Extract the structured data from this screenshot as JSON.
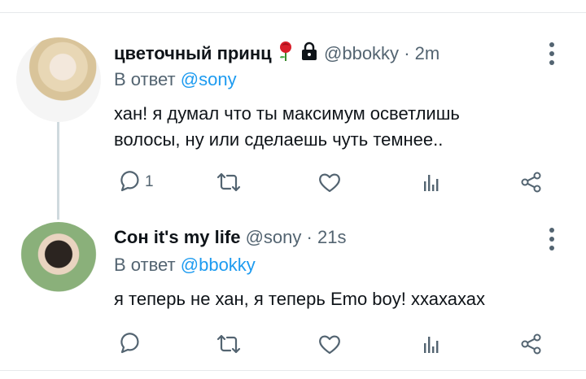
{
  "tweets": [
    {
      "display_name": "цветочный принц",
      "handle": "@bbokky",
      "time": "2m",
      "reply_prefix": "В ответ",
      "reply_to": "@sony",
      "text_line1": "хан! я думал что ты максимум осветлишь",
      "text_line2": "волосы, ну или сделаешь чуть темнее..",
      "reply_count": "1",
      "badges": [
        "rose-icon",
        "lock-icon"
      ]
    },
    {
      "display_name": "Сон it's my life",
      "handle": "@sony",
      "time": "21s",
      "reply_prefix": "В ответ",
      "reply_to": "@bbokky",
      "text_line1": "я теперь не хан, я теперь Emo boy! ххахахах",
      "reply_count": ""
    }
  ],
  "separator": "·",
  "icons": [
    "reply-icon",
    "retweet-icon",
    "like-icon",
    "analytics-icon",
    "share-icon",
    "more-icon"
  ],
  "colors": {
    "link": "#1d9bf0",
    "muted": "#536471",
    "text": "#0f1419"
  }
}
